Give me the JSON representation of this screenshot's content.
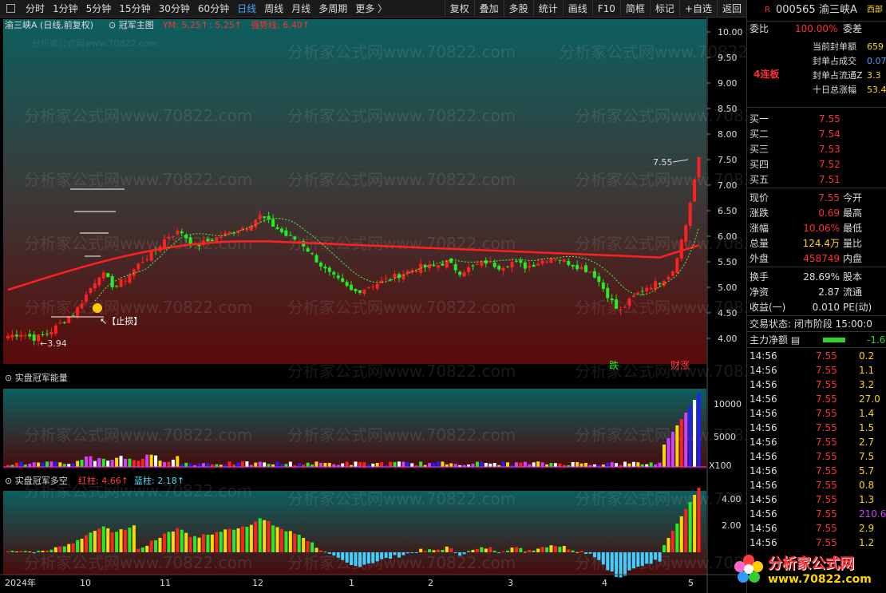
{
  "toolbar": {
    "tabs": [
      "分时",
      "1分钟",
      "5分钟",
      "15分钟",
      "30分钟",
      "60分钟",
      "日线",
      "周线",
      "月线",
      "多周期",
      "更多 〉"
    ],
    "active": 6,
    "tools": [
      "复权",
      "叠加",
      "多股",
      "统计",
      "画线",
      "F10",
      "简框",
      "标记",
      "+自选",
      "返回"
    ]
  },
  "main": {
    "title": "渝三峡A (日线,前复权)",
    "indicator": "冠军主图",
    "ym_label": "YM: 5.25↑",
    "v2_label": ": 5.25↑",
    "strong_label": "强势线: 6.40↑",
    "yaxis": [
      "10.00",
      "9.50",
      "9.00",
      "8.50",
      "8.00",
      "7.50",
      "7.00",
      "6.50",
      "6.00",
      "5.50",
      "5.00",
      "4.50",
      "4.00"
    ],
    "ann_high": "7.55",
    "ann_low": "3.94",
    "stop": "【止损】",
    "mark_die": "跌",
    "mark_zhang": "财涨"
  },
  "vol": {
    "title": "实盘冠军能量",
    "yaxis": [
      "10000",
      "5000"
    ],
    "unit": "X100"
  },
  "ls": {
    "title": "实盘冠军多空",
    "red_label": "红柱: 4.66↑",
    "blue_label": "蓝柱: 2.18↑",
    "yaxis": [
      "4.00",
      "2.00"
    ]
  },
  "xaxis": [
    "2024年",
    "10",
    "11",
    "12",
    "1",
    "2",
    "3",
    "4",
    "5"
  ],
  "watermark": "分析家公式网www.70822.com",
  "quote": {
    "code": "000565",
    "name": "渝三峡A",
    "flag": "R",
    "region": "西部",
    "weibi_label": "委比",
    "weibi": "100.00%",
    "weicha_label": "委差",
    "streak": "4连板",
    "seal": [
      {
        "l": "当前封单额",
        "v": "659"
      },
      {
        "l": "封单占成交",
        "v": "0.07"
      },
      {
        "l": "封单占流通Z",
        "v": "3.3"
      },
      {
        "l": "十日总涨幅",
        "v": "53.4"
      }
    ],
    "bids": [
      {
        "l": "买一",
        "v": "7.55"
      },
      {
        "l": "买二",
        "v": "7.54"
      },
      {
        "l": "买三",
        "v": "7.53"
      },
      {
        "l": "买四",
        "v": "7.52"
      },
      {
        "l": "买五",
        "v": "7.51"
      }
    ],
    "stats": [
      {
        "l": "现价",
        "v": "7.55",
        "l2": "今开",
        "c": "red"
      },
      {
        "l": "涨跌",
        "v": "0.69",
        "l2": "最高",
        "c": "red"
      },
      {
        "l": "涨幅",
        "v": "10.06%",
        "l2": "最低",
        "c": "red"
      },
      {
        "l": "总量",
        "v": "124.4万",
        "l2": "量比",
        "c": "yel"
      },
      {
        "l": "外盘",
        "v": "458749",
        "l2": "内盘",
        "c": "red"
      }
    ],
    "stats2": [
      {
        "l": "换手",
        "v": "28.69%",
        "l2": "股本"
      },
      {
        "l": "净资",
        "v": "2.87",
        "l2": "流通"
      },
      {
        "l": "收益(一)",
        "v": "0.010",
        "l2": "PE(动)"
      }
    ],
    "trade_status": "交易状态: 闭市阶段 15:00:0",
    "main_flow_label": "主力净额",
    "main_flow_val": "-1.6",
    "ticks": [
      {
        "t": "14:56",
        "p": "7.55",
        "v": "0.2"
      },
      {
        "t": "14:56",
        "p": "7.55",
        "v": "1.1"
      },
      {
        "t": "14:56",
        "p": "7.55",
        "v": "3.2"
      },
      {
        "t": "14:56",
        "p": "7.55",
        "v": "27.0"
      },
      {
        "t": "14:56",
        "p": "7.55",
        "v": "1.4"
      },
      {
        "t": "14:56",
        "p": "7.55",
        "v": "1.5"
      },
      {
        "t": "14:56",
        "p": "7.55",
        "v": "2.7"
      },
      {
        "t": "14:56",
        "p": "7.55",
        "v": "7.5"
      },
      {
        "t": "14:56",
        "p": "7.55",
        "v": "5.7"
      },
      {
        "t": "14:56",
        "p": "7.55",
        "v": "0.8"
      },
      {
        "t": "14:56",
        "p": "7.55",
        "v": "1.3"
      },
      {
        "t": "14:56",
        "p": "7.55",
        "v": "210.6"
      },
      {
        "t": "14:56",
        "p": "7.55",
        "v": "2.9"
      },
      {
        "t": "14:56",
        "p": "7.55",
        "v": "1.2"
      }
    ]
  },
  "logo": {
    "t1": "分析家公式网",
    "t2": "www.70822.com"
  }
}
